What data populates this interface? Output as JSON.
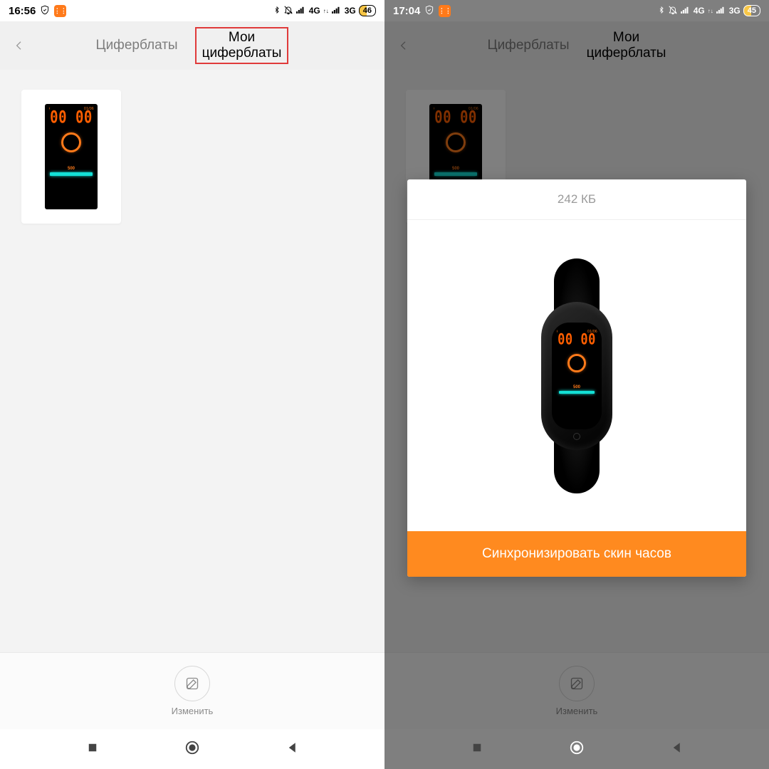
{
  "left": {
    "status": {
      "time": "16:56",
      "net1": "4G",
      "net2": "3G",
      "battery": "46"
    },
    "tabs": {
      "dials": "Циферблаты",
      "my_dials_l1": "Мои",
      "my_dials_l2": "циферблаты"
    },
    "watchface": {
      "date": "01/06",
      "digits": "00 00",
      "steps": "500"
    },
    "bottom": {
      "edit": "Изменить"
    }
  },
  "right": {
    "status": {
      "time": "17:04",
      "net1": "4G",
      "net2": "3G",
      "battery": "45"
    },
    "tabs": {
      "dials": "Циферблаты",
      "my_dials_l1": "Мои",
      "my_dials_l2": "циферблаты"
    },
    "watchface": {
      "date": "01/06",
      "digits": "00 00",
      "steps": "500"
    },
    "modal": {
      "size": "242 КБ",
      "sync": "Синхронизировать скин часов"
    },
    "bottom": {
      "edit": "Изменить"
    }
  }
}
